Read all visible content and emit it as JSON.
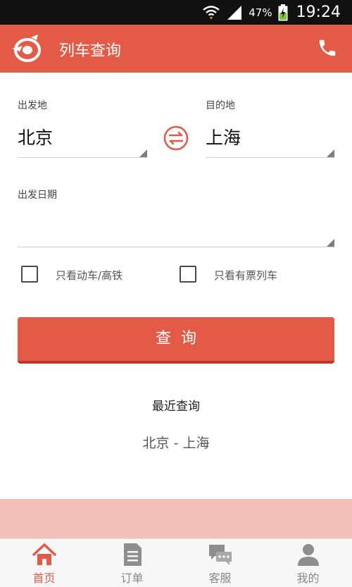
{
  "status_bar": {
    "battery_percent": "47%",
    "time": "19:24",
    "icons": [
      "wifi-icon",
      "signal-icon",
      "battery-charging-icon"
    ]
  },
  "app_bar": {
    "title": "列车查询",
    "logo_icon": "train-logo-icon",
    "phone_icon": "phone-icon"
  },
  "form": {
    "departure_label": "出发地",
    "departure_value": "北京",
    "destination_label": "目的地",
    "destination_value": "上海",
    "swap_icon": "swap-arrows-icon",
    "date_label": "出发日期",
    "date_value": "",
    "option_highspeed": {
      "label": "只看动车/高铁",
      "checked": false
    },
    "option_available": {
      "label": "只看有票列车",
      "checked": false
    },
    "query_button": "查询"
  },
  "recent": {
    "title": "最近查询",
    "items": [
      "北京 - 上海"
    ]
  },
  "bottom_nav": {
    "items": [
      {
        "label": "首页",
        "icon": "home-icon",
        "active": true
      },
      {
        "label": "订单",
        "icon": "document-icon",
        "active": false
      },
      {
        "label": "客服",
        "icon": "chat-icon",
        "active": false
      },
      {
        "label": "我的",
        "icon": "user-icon",
        "active": false
      }
    ]
  },
  "colors": {
    "primary": "#e35a47",
    "primary_dark": "#b63b2c",
    "status_bar": "#111111",
    "banner": "#f2c0b8",
    "inactive_nav": "#888888"
  }
}
